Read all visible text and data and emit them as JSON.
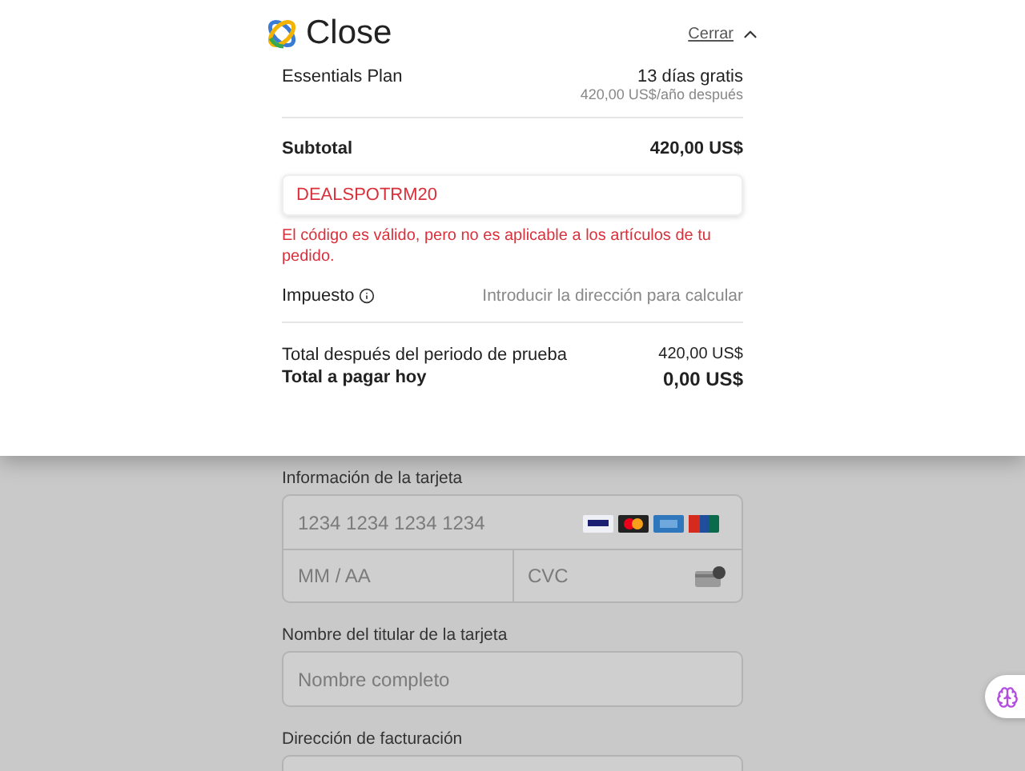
{
  "header": {
    "brand": "Close",
    "close_link": "Cerrar"
  },
  "summary": {
    "plan": {
      "name": "Essentials Plan",
      "price": "13 días gratis",
      "note": "420,00 US$/año después"
    },
    "subtotal": {
      "label": "Subtotal",
      "value": "420,00 US$"
    },
    "coupon": {
      "value": "DEALSPOTRM20",
      "error": "El código es válido, pero no es aplicable a los artículos de tu pedido."
    },
    "tax": {
      "label": "Impuesto",
      "value": "Introducir la dirección para calcular"
    },
    "after_trial": {
      "label": "Total después del periodo de prueba",
      "value": "420,00 US$"
    },
    "due_today": {
      "label": "Total a pagar hoy",
      "value": "0,00 US$"
    }
  },
  "form": {
    "card_label": "Información de la tarjeta",
    "card_number": {
      "placeholder": "1234 1234 1234 1234"
    },
    "expiry": {
      "placeholder": "MM / AA"
    },
    "cvc": {
      "placeholder": "CVC"
    },
    "name_label": "Nombre del titular de la tarjeta",
    "name": {
      "placeholder": "Nombre completo"
    },
    "address_label": "Dirección de facturación"
  }
}
